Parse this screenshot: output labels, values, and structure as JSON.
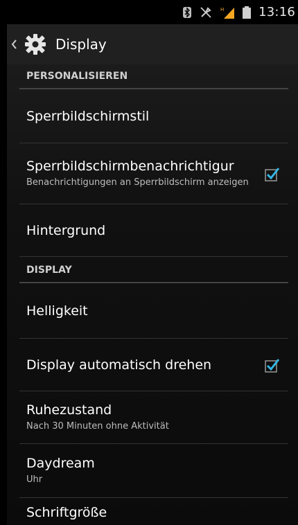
{
  "status_bar": {
    "time": "13:16",
    "icons": [
      "bluetooth-icon",
      "muted-icon",
      "signal-icon",
      "battery-icon"
    ]
  },
  "action_bar": {
    "title": "Display",
    "icons": [
      "back-arrow-icon",
      "settings-gear-icon"
    ]
  },
  "sections": [
    {
      "header": "PERSONALISIEREN",
      "items": [
        {
          "label": "Sperrbildschirmstil"
        },
        {
          "label": "Sperrbildschirmbenachrichtigur",
          "summary": "Benachrichtigungen an Sperrbildschirm anzeigen",
          "checked": true
        },
        {
          "label": "Hintergrund"
        }
      ]
    },
    {
      "header": "DISPLAY",
      "items": [
        {
          "label": "Helligkeit"
        },
        {
          "label": "Display automatisch drehen",
          "checked": true
        },
        {
          "label": "Ruhezustand",
          "summary": "Nach 30 Minuten ohne Aktivität"
        },
        {
          "label": "Daydream",
          "summary": "Uhr"
        },
        {
          "label": "Schriftgröße"
        }
      ]
    }
  ],
  "colors": {
    "accent": "#33b5e5",
    "background": "#0f0f0f",
    "actionbar": "#202020",
    "signal": "#f5a623"
  }
}
